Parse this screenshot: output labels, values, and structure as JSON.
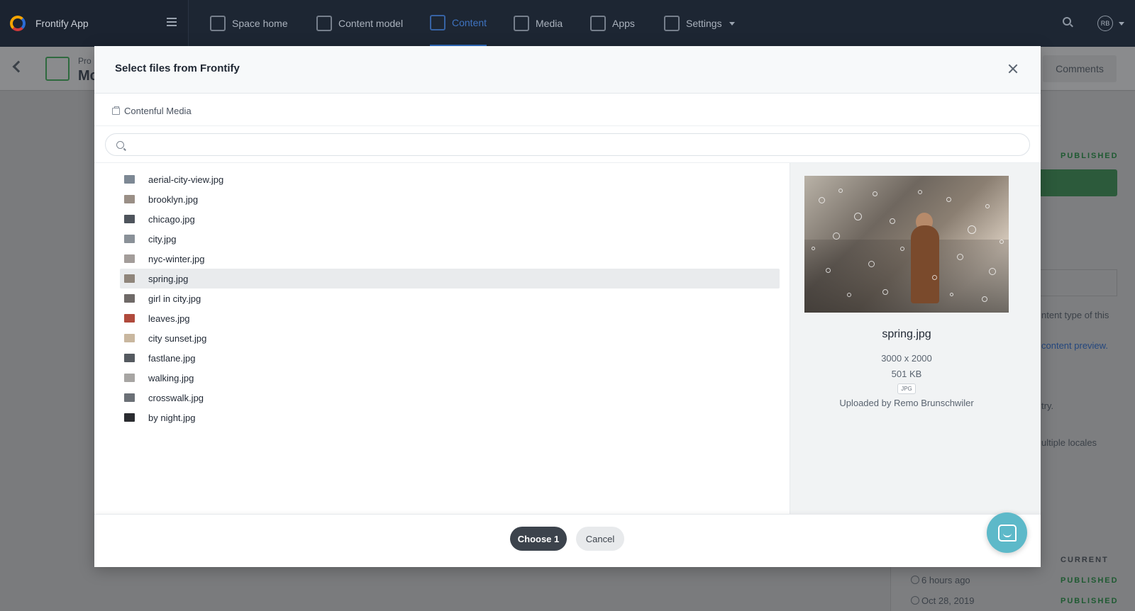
{
  "app": {
    "name": "Frontify App",
    "user_initials": "RB"
  },
  "nav": {
    "items": [
      {
        "label": "Space home",
        "icon": "home-icon"
      },
      {
        "label": "Content model",
        "icon": "cube-icon"
      },
      {
        "label": "Content",
        "icon": "edit-icon",
        "active": true
      },
      {
        "label": "Media",
        "icon": "image-icon"
      },
      {
        "label": "Apps",
        "icon": "puzzle-icon"
      },
      {
        "label": "Settings",
        "icon": "gear-icon"
      }
    ]
  },
  "background": {
    "entry_type": "Pro",
    "entry_title": "Mc",
    "comments_label": "Comments",
    "status_top": "PUBLISHED",
    "partial_input": "w",
    "partial_text_1": "ntent type of this",
    "partial_link": "content preview.",
    "partial_text_2": "try.",
    "partial_locales": "ultiple locales",
    "current_label": "CURRENT",
    "versions": [
      {
        "time": "6 hours ago",
        "status": "PUBLISHED"
      },
      {
        "time": "Oct 28, 2019",
        "status": "PUBLISHED"
      }
    ]
  },
  "modal": {
    "title": "Select files from Frontify",
    "breadcrumb": "Contenful Media",
    "search_placeholder": "",
    "files": [
      {
        "name": "aerial-city-view.jpg",
        "thumb_color": "#7d8894"
      },
      {
        "name": "brooklyn.jpg",
        "thumb_color": "#9a8f86"
      },
      {
        "name": "chicago.jpg",
        "thumb_color": "#4e545c"
      },
      {
        "name": "city.jpg",
        "thumb_color": "#8a9198"
      },
      {
        "name": "nyc-winter.jpg",
        "thumb_color": "#a39d9a"
      },
      {
        "name": "spring.jpg",
        "thumb_color": "#8f857b",
        "selected": true
      },
      {
        "name": "girl in city.jpg",
        "thumb_color": "#6f6a68"
      },
      {
        "name": "leaves.jpg",
        "thumb_color": "#b04a3c"
      },
      {
        "name": "city sunset.jpg",
        "thumb_color": "#c9b79f"
      },
      {
        "name": "fastlane.jpg",
        "thumb_color": "#555a60"
      },
      {
        "name": "walking.jpg",
        "thumb_color": "#a7a5a3"
      },
      {
        "name": "crosswalk.jpg",
        "thumb_color": "#6b7076"
      },
      {
        "name": "by night.jpg",
        "thumb_color": "#2a2c30"
      }
    ],
    "preview": {
      "name": "spring.jpg",
      "dimensions": "3000 x 2000",
      "size": "501 KB",
      "type": "JPG",
      "uploaded_by": "Uploaded by Remo Brunschwiler"
    },
    "choose_label": "Choose 1",
    "cancel_label": "Cancel"
  }
}
